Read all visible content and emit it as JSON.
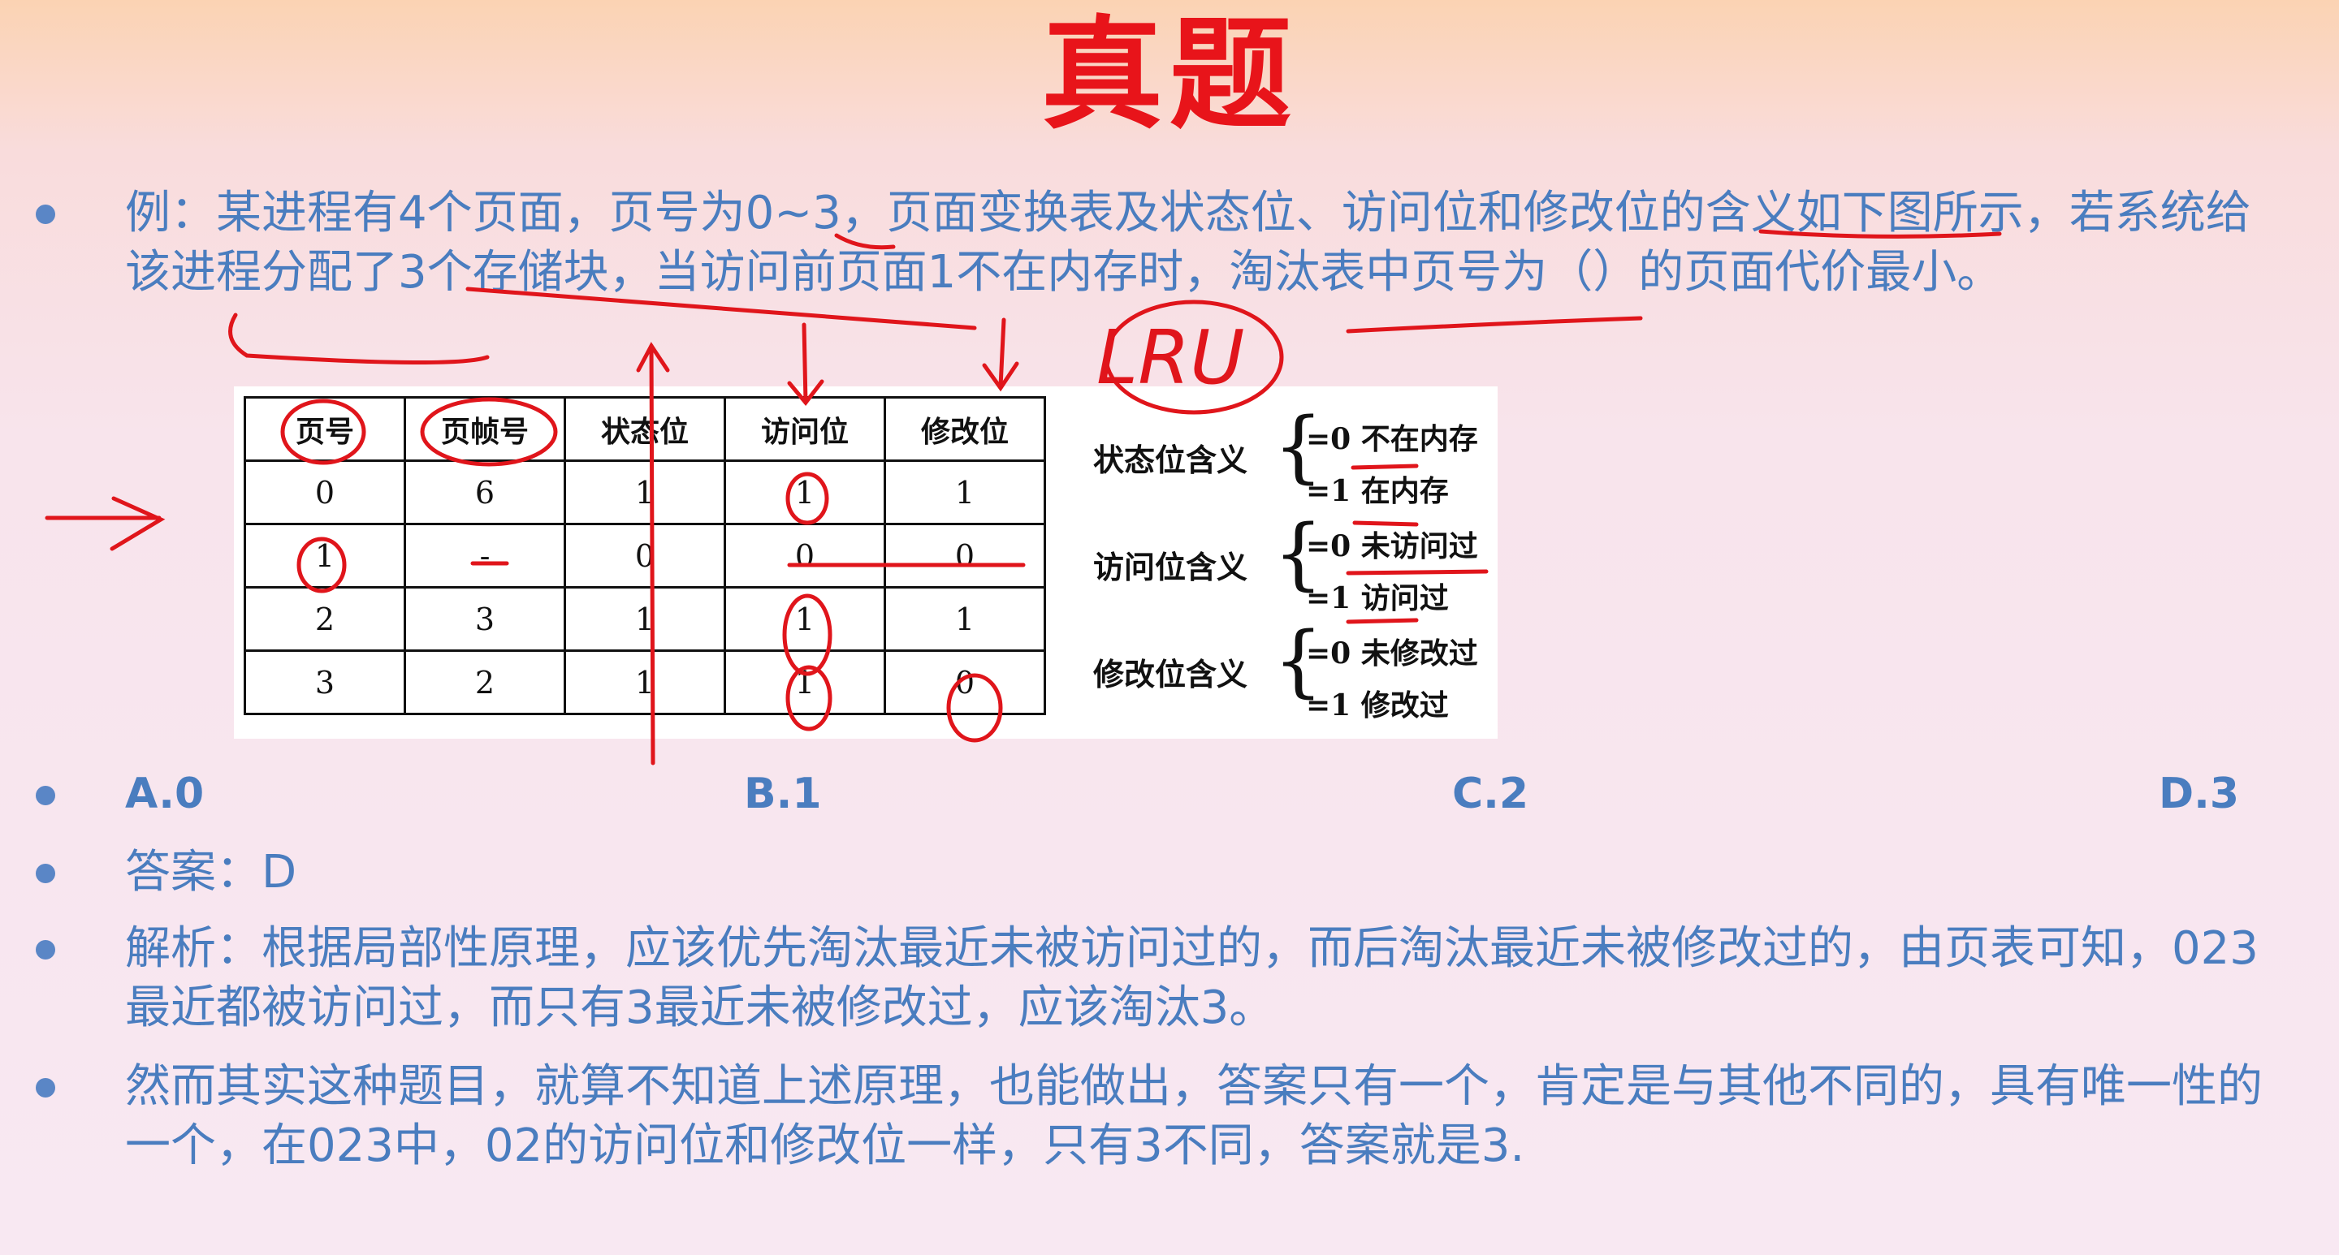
{
  "title": "真题",
  "question": "例：某进程有4个页面，页号为0~3，页面变换表及状态位、访问位和修改位的含义如下图所示，若系统给该进程分配了3个存储块，当访问前页面1不在内存时，淘汰表中页号为（）的页面代价最小。",
  "annotation": "LRU",
  "table": {
    "headers": [
      "页号",
      "页帧号",
      "状态位",
      "访问位",
      "修改位"
    ],
    "rows": [
      [
        "0",
        "6",
        "1",
        "1",
        "1"
      ],
      [
        "1",
        "-",
        "0",
        "0",
        "0"
      ],
      [
        "2",
        "3",
        "1",
        "1",
        "1"
      ],
      [
        "3",
        "2",
        "1",
        "1",
        "0"
      ]
    ]
  },
  "legend": [
    {
      "label": "状态位含义",
      "v0": "=0 不在内存",
      "v1": "=1 在内存"
    },
    {
      "label": "访问位含义",
      "v0": "=0 未访问过",
      "v1": "=1 访问过"
    },
    {
      "label": "修改位含义",
      "v0": "=0 未修改过",
      "v1": "=1 修改过"
    }
  ],
  "options": [
    "A.0",
    "B.1",
    "C.2",
    "D.3"
  ],
  "answer": "答案：D",
  "analysis": "解析：根据局部性原理，应该优先淘汰最近未被访问过的，而后淘汰最近未被修改过的，由页表可知，023最近都被访问过，而只有3最近未被修改过，应该淘汰3。",
  "note": "然而其实这种题目，就算不知道上述原理，也能做出，答案只有一个，肯定是与其他不同的，具有唯一性的一个，在023中，02的访问位和修改位一样，只有3不同，答案就是3.",
  "colors": {
    "title": "#e8141a",
    "text": "#4a7dbf",
    "ink": "#e0151b"
  }
}
